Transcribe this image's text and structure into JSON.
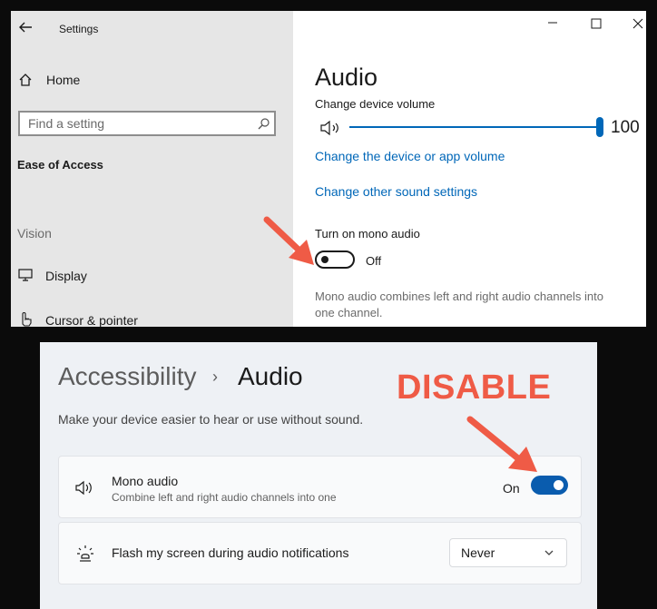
{
  "win10": {
    "title": "Settings",
    "back_icon": "arrow-left-icon",
    "caption_icons": [
      "minimize-icon",
      "maximize-icon",
      "close-icon"
    ],
    "sidebar": {
      "home_label": "Home",
      "search_placeholder": "Find a setting",
      "section_title": "Ease of Access",
      "group_label": "Vision",
      "items": [
        {
          "label": "Display",
          "icon": "monitor-icon"
        },
        {
          "label": "Cursor & pointer",
          "icon": "pointer-hand-icon"
        }
      ]
    },
    "main": {
      "page_title": "Audio",
      "device_volume_label": "Change device volume",
      "volume_value": "100",
      "volume_level": 1.0,
      "link_app_volume": "Change the device or app volume",
      "link_other_sound": "Change other sound settings",
      "mono_label": "Turn on mono audio",
      "mono_state": "Off",
      "mono_description_line1": "Mono audio combines left and right audio channels into",
      "mono_description_line2": "one channel."
    }
  },
  "win11": {
    "breadcrumb_parent": "Accessibility",
    "breadcrumb_separator": "›",
    "breadcrumb_current": "Audio",
    "description": "Make your device easier to hear or use without sound.",
    "mono": {
      "title": "Mono audio",
      "subtitle": "Combine left and right audio channels into one",
      "state": "On",
      "icon": "speaker-icon"
    },
    "flash": {
      "title": "Flash my screen during audio notifications",
      "icon": "flash-bulb-icon",
      "selected": "Never"
    }
  },
  "annotation": {
    "label": "DISABLE",
    "color": "#ef5b46"
  },
  "colors": {
    "accent_win10": "#0067b8",
    "accent_win11": "#0a5cae"
  }
}
